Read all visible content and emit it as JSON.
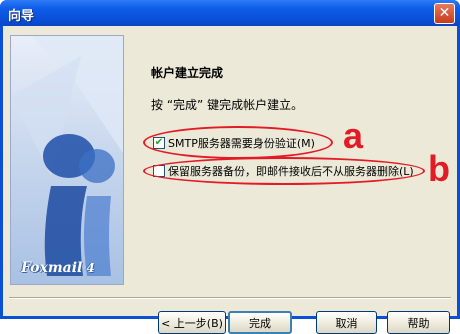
{
  "window": {
    "title": "向导"
  },
  "banner": {
    "logo_text": "Foxmail",
    "logo_version": "4"
  },
  "page": {
    "heading": "帐户建立完成",
    "instruction": "按 “完成” 键完成帐户建立。"
  },
  "options": [
    {
      "label": "SMTP服务器需要身份验证(M)",
      "checked": true
    },
    {
      "label": "保留服务器备份，即邮件接收后不从服务器删除(L)",
      "checked": false
    }
  ],
  "annotations": {
    "a": "a",
    "b": "b",
    "color": "#e31b25"
  },
  "buttons": {
    "back": "< 上一步(B)",
    "finish": "完成",
    "cancel": "取消",
    "help": "帮助"
  }
}
